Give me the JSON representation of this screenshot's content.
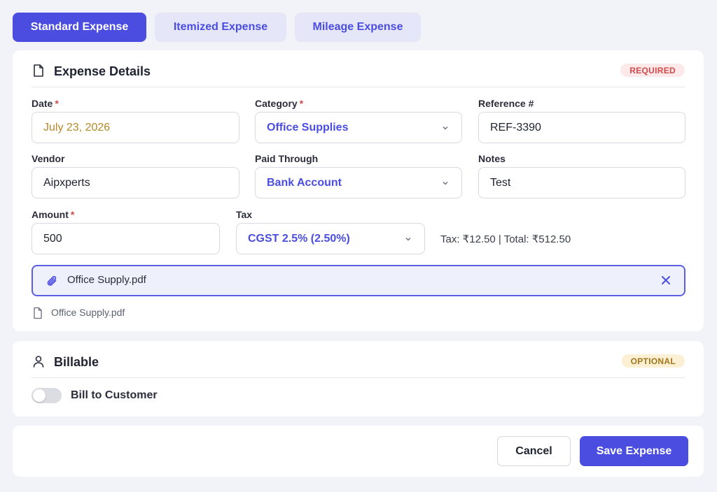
{
  "tabs": [
    {
      "label": "Standard Expense"
    },
    {
      "label": "Itemized Expense"
    },
    {
      "label": "Mileage Expense"
    }
  ],
  "expense_details": {
    "title": "Expense Details",
    "badge": "REQUIRED",
    "icon": "document-icon",
    "fields": {
      "date": {
        "label": "Date",
        "required_mark": "*",
        "value": "July 23, 2026"
      },
      "category": {
        "label": "Category",
        "required_mark": "*",
        "value": "Office Supplies"
      },
      "reference": {
        "label": "Reference #",
        "value": "REF-3390"
      },
      "vendor": {
        "label": "Vendor",
        "value": "Aipxperts"
      },
      "paid_through": {
        "label": "Paid Through",
        "value": "Bank Account"
      },
      "notes": {
        "label": "Notes",
        "value": "Test"
      },
      "amount": {
        "label": "Amount",
        "required_mark": "*",
        "value": "500"
      },
      "tax": {
        "label": "Tax",
        "value": "CGST 2.5% (2.50%)"
      }
    },
    "tax_summary": "Tax: ₹12.50 | Total: ₹512.50",
    "attachment": {
      "name": "Office Supply.pdf"
    },
    "file_list": [
      {
        "name": "Office Supply.pdf"
      }
    ]
  },
  "billable": {
    "title": "Billable",
    "badge": "OPTIONAL",
    "icon": "user-icon",
    "toggle_label": "Bill to Customer",
    "toggle_on": false
  },
  "actions": {
    "cancel_label": "Cancel",
    "save_label": "Save Expense"
  },
  "colors": {
    "accent": "#4a4de0",
    "required_badge": "#d14a4a",
    "optional_badge": "#a0761a",
    "date_text": "#b58a28"
  }
}
